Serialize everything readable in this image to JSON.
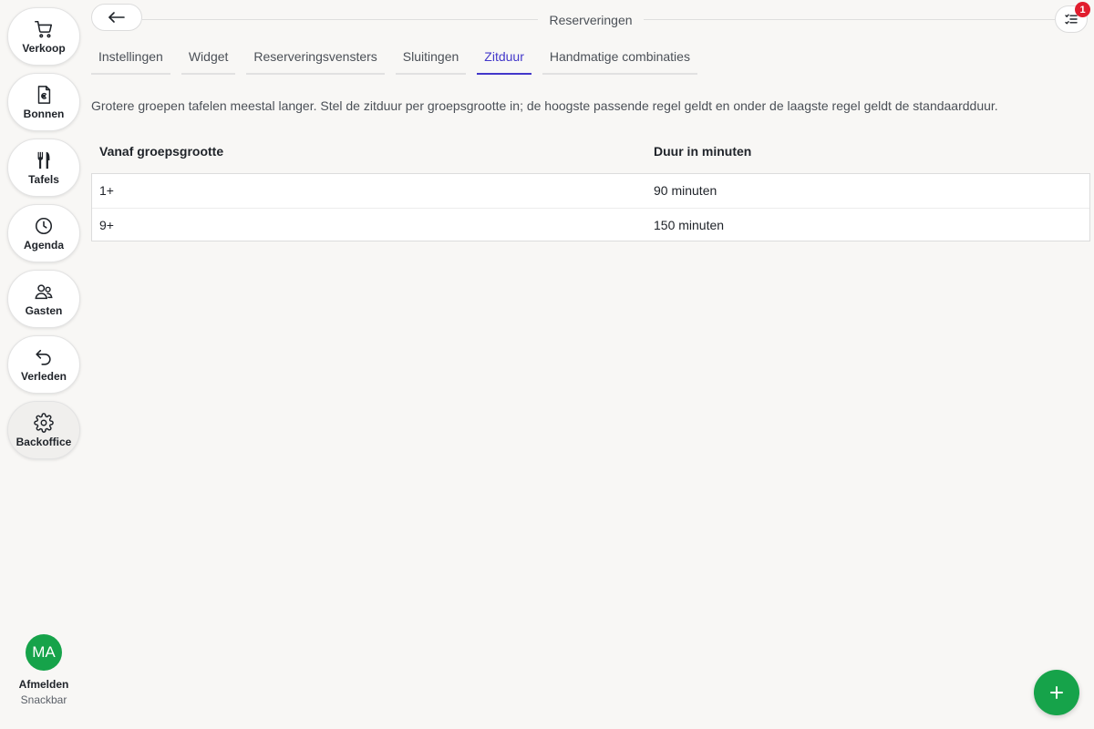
{
  "sidebar": {
    "items": [
      {
        "label": "Verkoop",
        "icon": "cart-icon"
      },
      {
        "label": "Bonnen",
        "icon": "receipt-euro-icon"
      },
      {
        "label": "Tafels",
        "icon": "fork-knife-icon"
      },
      {
        "label": "Agenda",
        "icon": "clock-icon"
      },
      {
        "label": "Gasten",
        "icon": "users-icon"
      },
      {
        "label": "Verleden",
        "icon": "undo-arrow-icon"
      },
      {
        "label": "Backoffice",
        "icon": "gear-icon",
        "active": true
      }
    ],
    "user": {
      "initials": "MA",
      "logout_label": "Afmelden",
      "store": "Snackbar"
    }
  },
  "header": {
    "title": "Reserveringen",
    "notification_count": "1"
  },
  "tabs": [
    {
      "label": "Instellingen"
    },
    {
      "label": "Widget"
    },
    {
      "label": "Reserveringsvensters"
    },
    {
      "label": "Sluitingen"
    },
    {
      "label": "Zitduur",
      "active": true
    },
    {
      "label": "Handmatige combinaties"
    }
  ],
  "description": "Grotere groepen tafelen meestal langer. Stel de zitduur per groepsgrootte in; de hoogste passende regel geldt en onder de laagste regel geldt de standaardduur.",
  "table": {
    "headers": [
      "Vanaf groepsgrootte",
      "Duur in minuten"
    ],
    "rows": [
      [
        "1+",
        "90 minuten"
      ],
      [
        "9+",
        "150 minuten"
      ]
    ]
  },
  "colors": {
    "accent": "#4338ca",
    "primary_green": "#16a34a",
    "badge_red": "#e11d2e",
    "background": "#f8f7f5"
  }
}
